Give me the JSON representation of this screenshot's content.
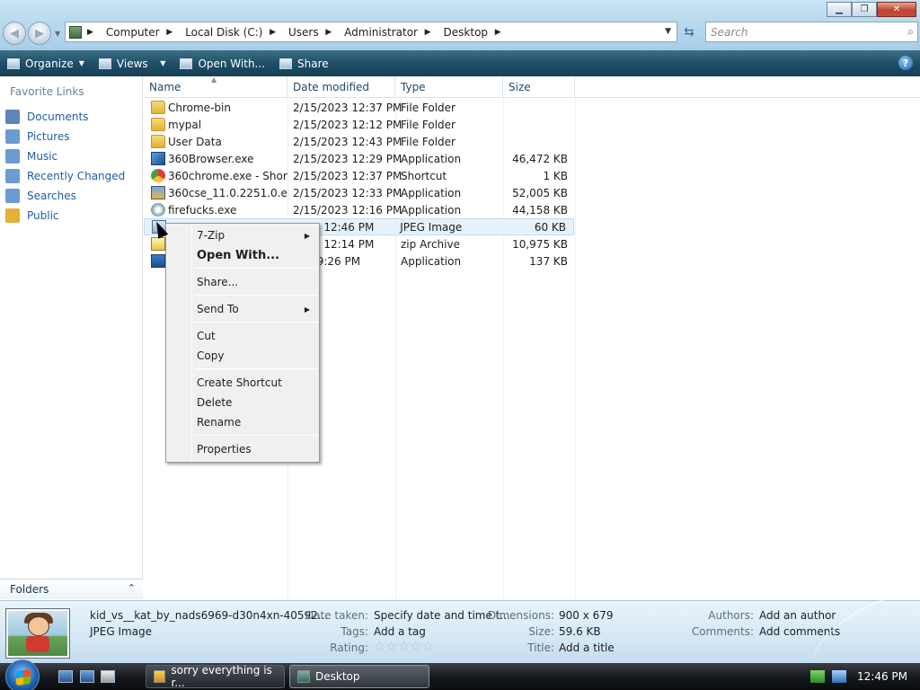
{
  "address": {
    "crumbs": [
      "Computer",
      "Local Disk (C:)",
      "Users",
      "Administrator",
      "Desktop"
    ],
    "search_placeholder": "Search"
  },
  "commandbar": {
    "organize": "Organize",
    "views": "Views",
    "open_with": "Open With...",
    "share": "Share",
    "help": "?"
  },
  "sidebar": {
    "title": "Favorite Links",
    "items": [
      {
        "label": "Documents",
        "icon": "documents-icon",
        "color": "#5b86b8"
      },
      {
        "label": "Pictures",
        "icon": "pictures-icon",
        "color": "#6a9cd2"
      },
      {
        "label": "Music",
        "icon": "music-icon",
        "color": "#6a9cd2"
      },
      {
        "label": "Recently Changed",
        "icon": "recent-icon",
        "color": "#6a9cd2"
      },
      {
        "label": "Searches",
        "icon": "searches-icon",
        "color": "#6a9cd2"
      },
      {
        "label": "Public",
        "icon": "folder-icon",
        "color": "#e2b236"
      }
    ],
    "folders_label": "Folders"
  },
  "columns": {
    "name": "Name",
    "date": "Date modified",
    "type": "Type",
    "size": "Size"
  },
  "files": [
    {
      "name": "Chrome-bin",
      "date": "2/15/2023 12:37 PM",
      "type": "File Folder",
      "size": "",
      "icon": "folder"
    },
    {
      "name": "mypal",
      "date": "2/15/2023 12:12 PM",
      "type": "File Folder",
      "size": "",
      "icon": "folder"
    },
    {
      "name": "User Data",
      "date": "2/15/2023 12:43 PM",
      "type": "File Folder",
      "size": "",
      "icon": "folder"
    },
    {
      "name": "360Browser.exe",
      "date": "2/15/2023 12:29 PM",
      "type": "Application",
      "size": "46,472 KB",
      "icon": "app1"
    },
    {
      "name": "360chrome.exe - Short...",
      "date": "2/15/2023 12:37 PM",
      "type": "Shortcut",
      "size": "1 KB",
      "icon": "shortcut"
    },
    {
      "name": "360cse_11.0.2251.0.exe",
      "date": "2/15/2023 12:33 PM",
      "type": "Application",
      "size": "52,005 KB",
      "icon": "app2"
    },
    {
      "name": "firefucks.exe",
      "date": "2/15/2023 12:16 PM",
      "type": "Application",
      "size": "44,158 KB",
      "icon": "app3"
    },
    {
      "name": "",
      "date": "2023 12:46 PM",
      "type": "JPEG Image",
      "size": "60 KB",
      "icon": "jpg",
      "selected": true
    },
    {
      "name": "",
      "date": "2023 12:14 PM",
      "type": "zip Archive",
      "size": "10,975 KB",
      "icon": "zip"
    },
    {
      "name": "",
      "date": "021 9:26 PM",
      "type": "Application",
      "size": "137 KB",
      "icon": "app4"
    }
  ],
  "context_menu": {
    "zip": "7-Zip",
    "open_with": "Open With...",
    "share": "Share...",
    "send_to": "Send To",
    "cut": "Cut",
    "copy": "Copy",
    "create_shortcut": "Create Shortcut",
    "delete": "Delete",
    "rename": "Rename",
    "properties": "Properties"
  },
  "details": {
    "filename": "kid_vs__kat_by_nads6969-d30n4xn-40592...",
    "filetype": "JPEG Image",
    "date_taken_label": "Date taken:",
    "date_taken_value": "Specify date and time t...",
    "tags_label": "Tags:",
    "tags_value": "Add a tag",
    "rating_label": "Rating:",
    "rating_stars": "☆☆☆☆☆",
    "dimensions_label": "Dimensions:",
    "dimensions_value": "900 x 679",
    "size_label": "Size:",
    "size_value": "59.6 KB",
    "title_label": "Title:",
    "title_value": "Add a title",
    "authors_label": "Authors:",
    "authors_value": "Add an author",
    "comments_label": "Comments:",
    "comments_value": "Add comments"
  },
  "taskbar": {
    "task1": "sorry everything is r...",
    "task2": "Desktop",
    "clock": "12:46 PM"
  }
}
